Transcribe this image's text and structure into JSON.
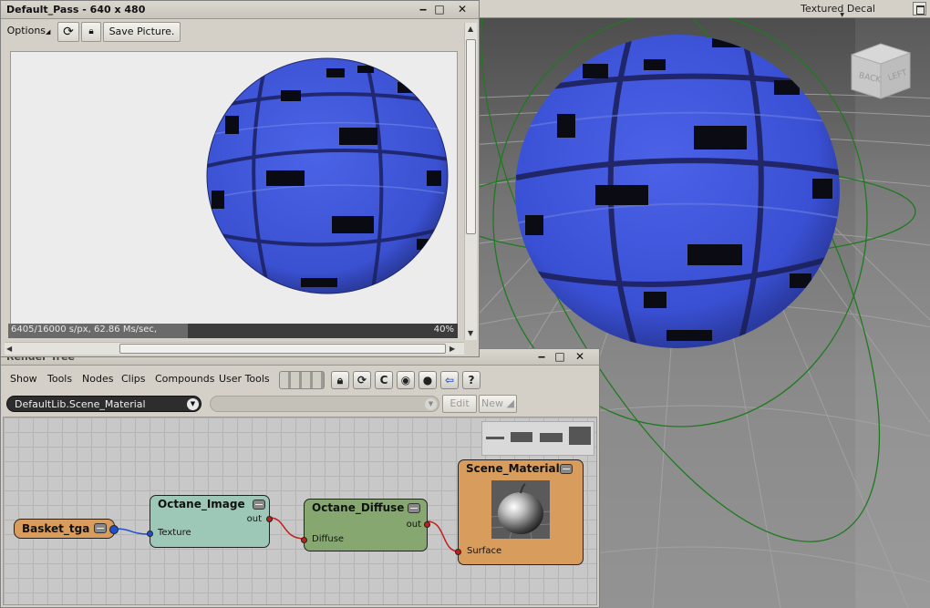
{
  "viewport": {
    "shading_mode": "Textured Decal",
    "view_cube": {
      "back_label": "BACK",
      "left_label": "LEFT"
    }
  },
  "render_window": {
    "title": "Default_Pass - 640 x 480",
    "options_label": "Options",
    "save_label": "Save Picture.",
    "status_text": "6405/16000 s/px, 62.86 Ms/sec,",
    "progress_percent": "40%",
    "progress_value": 0.4
  },
  "render_tree": {
    "title": "Render Tree",
    "menu": [
      "Show",
      "Tools",
      "Nodes",
      "Clips",
      "Compounds",
      "User Tools"
    ],
    "library_selection": "DefaultLib.Scene_Material",
    "edit_label": "Edit",
    "new_label": "New",
    "nodes": {
      "basket": {
        "title": "Basket_tga"
      },
      "image": {
        "title": "Octane_Image",
        "output": "out",
        "input": "Texture"
      },
      "diffuse": {
        "title": "Octane_Diffuse",
        "output": "out",
        "input": "Diffuse"
      },
      "material": {
        "title": "Scene_Material",
        "input": "Surface"
      }
    }
  },
  "colors": {
    "sphere_blue": "#3f55dd",
    "node_image": "#9dc7b6",
    "node_diffuse": "#86a870",
    "node_material": "#d89c5c",
    "node_basket": "#d89c5c",
    "wire_red": "#c0201a",
    "wire_blue": "#2050d0",
    "grid_green": "#2e8a2e"
  }
}
